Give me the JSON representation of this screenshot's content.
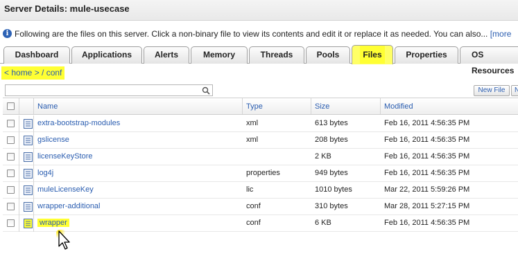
{
  "window": {
    "title": "Server Details: mule-usecase"
  },
  "info": {
    "icon": "info-icon",
    "text": "Following are the files on this server. Click a non-binary file to view its contents and edit it or replace it as needed. You can also...",
    "more_link": "[more"
  },
  "tabs": [
    {
      "label": "Dashboard",
      "active": false
    },
    {
      "label": "Applications",
      "active": false
    },
    {
      "label": "Alerts",
      "active": false
    },
    {
      "label": "Memory",
      "active": false
    },
    {
      "label": "Threads",
      "active": false
    },
    {
      "label": "Pools",
      "active": false
    },
    {
      "label": "Files",
      "active": true
    },
    {
      "label": "Properties",
      "active": false
    },
    {
      "label": "OS Resources",
      "active": false
    }
  ],
  "breadcrumb": "< home > / conf",
  "search": {
    "value": "",
    "placeholder": "",
    "icon": "search-icon"
  },
  "toolbar": {
    "new_file_label": "New File",
    "next_label": "N"
  },
  "table": {
    "columns": [
      "Name",
      "Type",
      "Size",
      "Modified"
    ],
    "rows": [
      {
        "name": "extra-bootstrap-modules",
        "type": "xml",
        "size": "613 bytes",
        "modified": "Feb 16, 2011 4:56:35 PM",
        "highlighted": false
      },
      {
        "name": "gslicense",
        "type": "xml",
        "size": "208 bytes",
        "modified": "Feb 16, 2011 4:56:35 PM",
        "highlighted": false
      },
      {
        "name": "licenseKeyStore",
        "type": "",
        "size": "2 KB",
        "modified": "Feb 16, 2011 4:56:35 PM",
        "highlighted": false
      },
      {
        "name": "log4j",
        "type": "properties",
        "size": "949 bytes",
        "modified": "Feb 16, 2011 4:56:35 PM",
        "highlighted": false
      },
      {
        "name": "muleLicenseKey",
        "type": "lic",
        "size": "1010 bytes",
        "modified": "Mar 22, 2011 5:59:26 PM",
        "highlighted": false
      },
      {
        "name": "wrapper-additional",
        "type": "conf",
        "size": "310 bytes",
        "modified": "Mar 28, 2011 5:27:15 PM",
        "highlighted": false
      },
      {
        "name": "wrapper",
        "type": "conf",
        "size": "6 KB",
        "modified": "Feb 16, 2011 4:56:35 PM",
        "highlighted": true
      }
    ]
  },
  "colors": {
    "link": "#2a5db0",
    "highlight": "#ffff33",
    "info_icon": "#2d62b5"
  }
}
